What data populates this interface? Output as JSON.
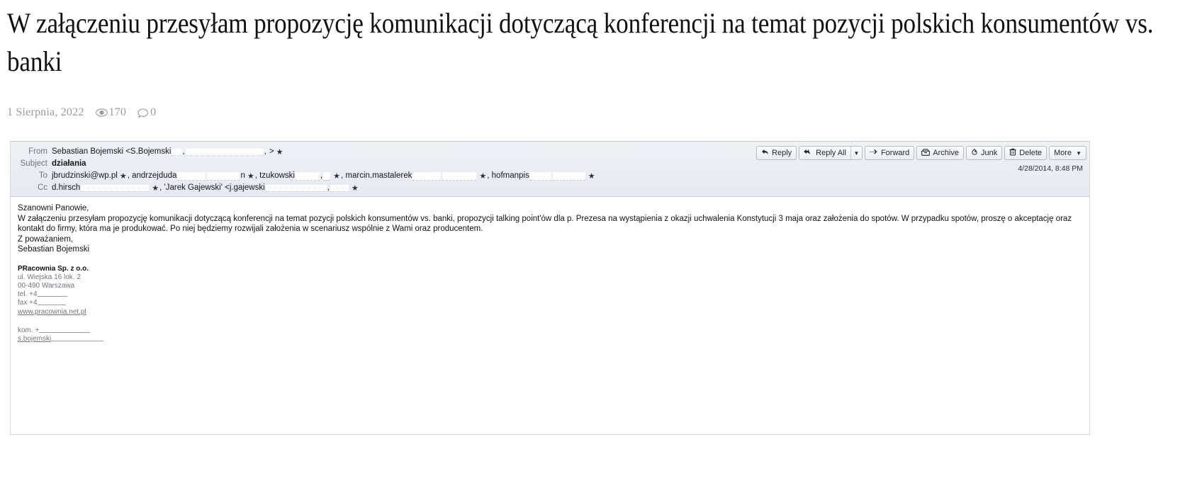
{
  "article": {
    "title": "W załączeniu przesyłam propozycję komunikacji dotyczącą konferencji na temat pozycji polskich konsumentów vs. banki",
    "date": "1 Sierpnia, 2022",
    "views": "170",
    "comments": "0"
  },
  "email": {
    "labels": {
      "from": "From",
      "subject": "Subject",
      "to": "To",
      "cc": "Cc"
    },
    "from": "Sebastian Bojemski <S.Bojemski",
    "from_tail": ">",
    "subject": "działania",
    "to_parts": [
      "jbrudzinski@wp.pl",
      ", andrzejduda",
      "n",
      ", tzukowski",
      ", marcin.mastalerek",
      ", hofmanpis"
    ],
    "cc_parts": [
      "d.hirsch",
      ", 'Jarek Gajewski' <j.gajewski"
    ],
    "date": "4/28/2014, 8:48 PM",
    "toolbar": {
      "reply": "Reply",
      "reply_all": "Reply All",
      "forward": "Forward",
      "archive": "Archive",
      "junk": "Junk",
      "delete": "Delete",
      "more": "More"
    },
    "body": {
      "greeting": "Szanowni Panowie,",
      "paragraph": "W załączeniu przesyłam propozycję komunikacji dotyczącą konferencji na temat pozycji polskich konsumentów vs. banki, propozycji talking point'ów  dla p. Prezesa na wystąpienia z okazji uchwalenia Konstytucji 3 maja oraz założenia do spotów. W przypadku spotów, proszę o akceptację oraz kontakt do firmy, która ma je produkować. Po niej będziemy rozwijali założenia w scenariusz wspólnie z Wami oraz producentem.",
      "closing": "Z poważaniem,",
      "signer": "Sebastian Bojemski",
      "company": "PRacownia Sp. z o.o.",
      "street": "ul. Wiejska 16 lok. 2",
      "city": "00-490 Warszawa",
      "tel": "tel. +4",
      "fax": "fax +4",
      "website": "www.pracownia.net.pl",
      "mobile": "kom. +",
      "email": "s.bojemski"
    }
  },
  "colors": {
    "header_bg": "#e9ecf2",
    "meta_text": "#9b9b9b",
    "link": "#2b3a7a"
  }
}
